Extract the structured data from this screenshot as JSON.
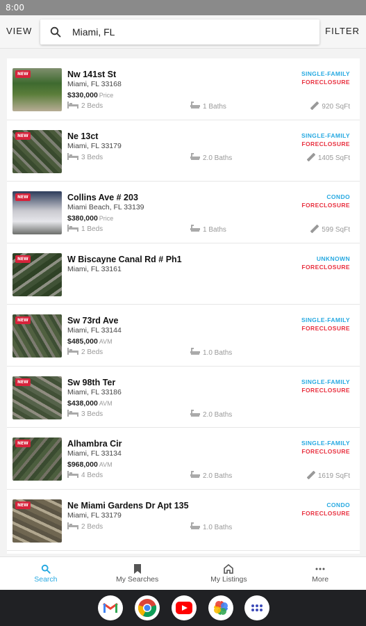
{
  "status_bar": {
    "time": "8:00"
  },
  "header": {
    "view_label": "VIEW",
    "filter_label": "FILTER",
    "search_value": "Miami, FL"
  },
  "listings": [
    {
      "address": "Nw 141st St",
      "city": "Miami, FL 33168",
      "price": "$330,000",
      "price_type": "Price",
      "beds": "2 Beds",
      "baths": "1 Baths",
      "sqft": "920 SqFt",
      "property_type": "SINGLE-FAMILY",
      "status": "FORECLOSURE",
      "badge": "NEW"
    },
    {
      "address": "Ne 13ct",
      "city": "Miami, FL 33179",
      "price": "",
      "price_type": "",
      "beds": "3 Beds",
      "baths": "2.0 Baths",
      "sqft": "1405 SqFt",
      "property_type": "SINGLE-FAMILY",
      "status": "FORECLOSURE",
      "badge": "NEW"
    },
    {
      "address": "Collins Ave # 203",
      "city": "Miami Beach, FL 33139",
      "price": "$380,000",
      "price_type": "Price",
      "beds": "1 Beds",
      "baths": "1 Baths",
      "sqft": "599 SqFt",
      "property_type": "CONDO",
      "status": "FORECLOSURE",
      "badge": "NEW"
    },
    {
      "address": "W Biscayne Canal Rd # Ph1",
      "city": "Miami, FL 33161",
      "price": "",
      "price_type": "",
      "beds": "",
      "baths": "",
      "sqft": "",
      "property_type": "UNKNOWN",
      "status": "FORECLOSURE",
      "badge": "NEW"
    },
    {
      "address": "Sw 73rd Ave",
      "city": "Miami, FL 33144",
      "price": "$485,000",
      "price_type": "AVM",
      "beds": "2 Beds",
      "baths": "1.0 Baths",
      "sqft": "",
      "property_type": "SINGLE-FAMILY",
      "status": "FORECLOSURE",
      "badge": "NEW"
    },
    {
      "address": "Sw 98th Ter",
      "city": "Miami, FL 33186",
      "price": "$438,000",
      "price_type": "AVM",
      "beds": "3 Beds",
      "baths": "2.0 Baths",
      "sqft": "",
      "property_type": "SINGLE-FAMILY",
      "status": "FORECLOSURE",
      "badge": "NEW"
    },
    {
      "address": "Alhambra Cir",
      "city": "Miami, FL 33134",
      "price": "$968,000",
      "price_type": "AVM",
      "beds": "4 Beds",
      "baths": "2.0 Baths",
      "sqft": "1619 SqFt",
      "property_type": "SINGLE-FAMILY",
      "status": "FORECLOSURE",
      "badge": "NEW"
    },
    {
      "address": "Ne Miami Gardens Dr Apt 135",
      "city": "Miami, FL 33179",
      "price": "",
      "price_type": "",
      "beds": "2 Beds",
      "baths": "1.0 Baths",
      "sqft": "",
      "property_type": "CONDO",
      "status": "FORECLOSURE",
      "badge": "NEW"
    }
  ],
  "bottom_nav": [
    {
      "label": "Search",
      "icon": "search-icon",
      "active": true
    },
    {
      "label": "My Searches",
      "icon": "bookmark-icon",
      "active": false
    },
    {
      "label": "My Listings",
      "icon": "home-icon",
      "active": false
    },
    {
      "label": "More",
      "icon": "more-icon",
      "active": false
    }
  ],
  "dock": [
    "gmail-icon",
    "chrome-icon",
    "youtube-icon",
    "photos-icon",
    "app-drawer-icon"
  ],
  "colors": {
    "accent": "#27a9e1",
    "status": "#e8303f",
    "badge": "#d6233b"
  }
}
